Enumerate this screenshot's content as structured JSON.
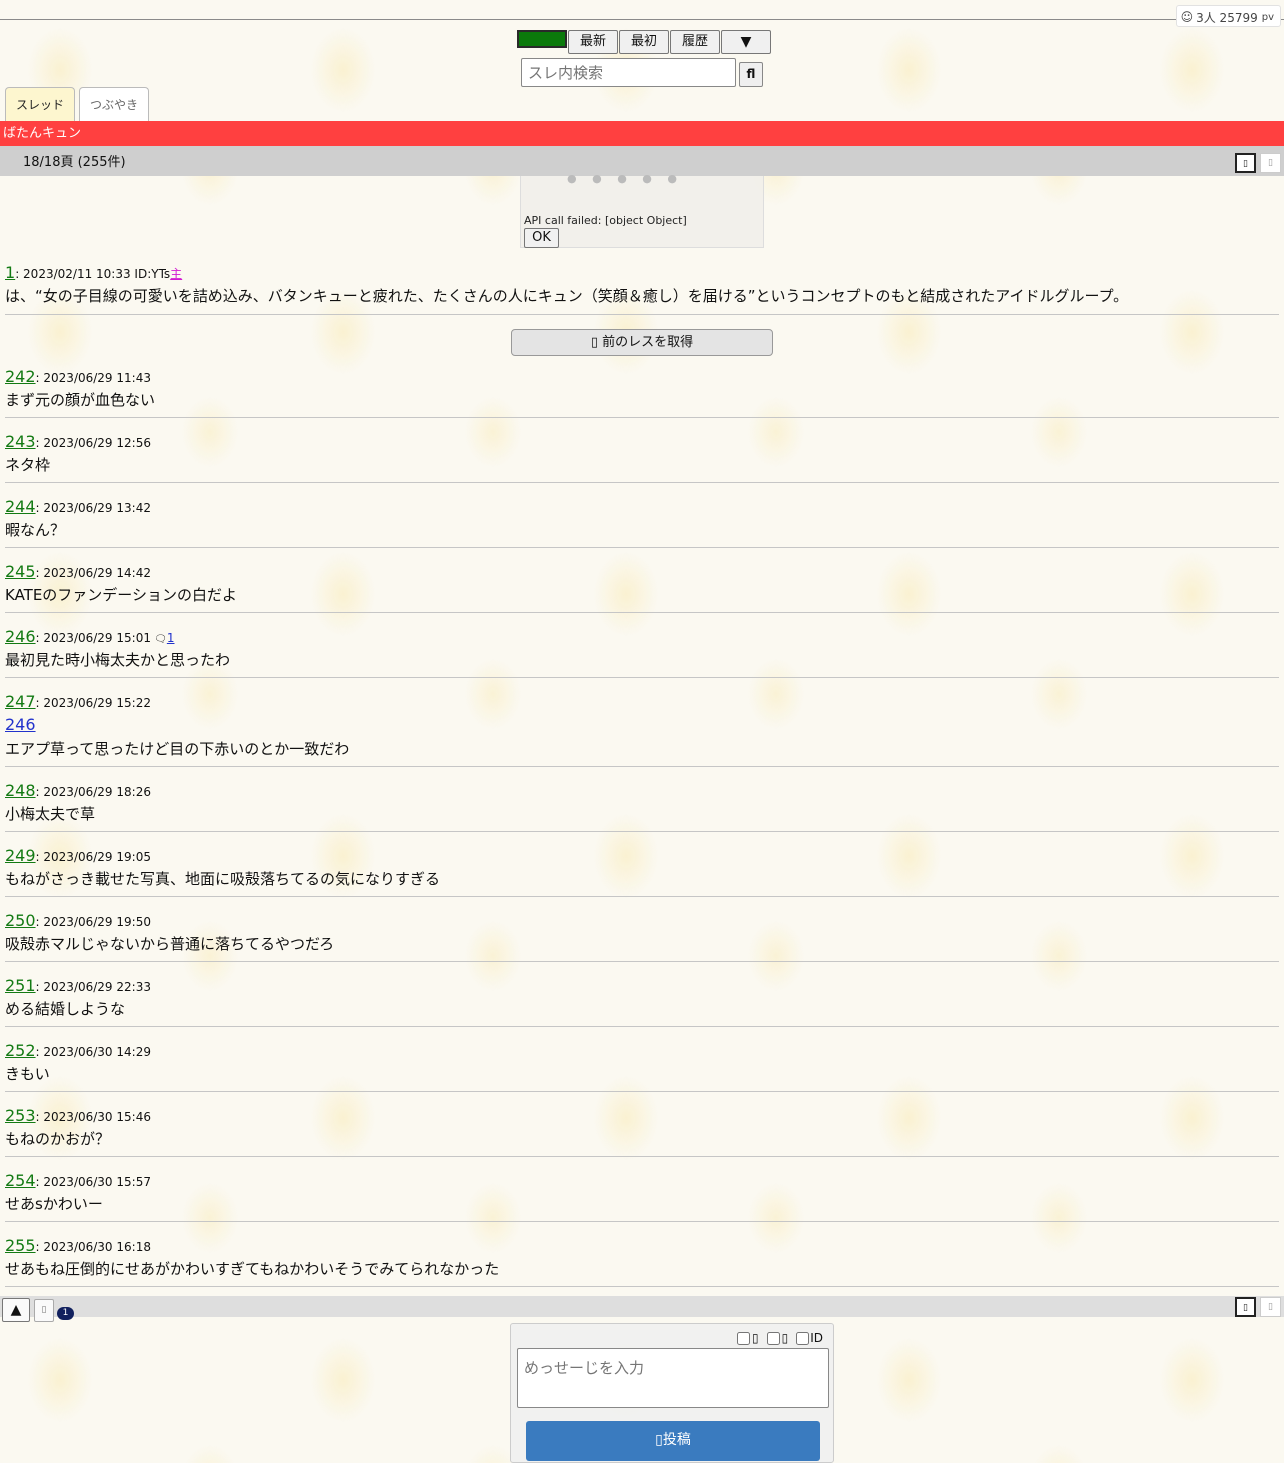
{
  "counter": {
    "icon": "chat-face-icon",
    "people": "3人 25799",
    "unit": "pv"
  },
  "nav": {
    "green_label": "",
    "latest": "最新",
    "first": "最初",
    "history": "履歴",
    "dropdown": "▼"
  },
  "search": {
    "placeholder": "スレ内検索",
    "button": "fl"
  },
  "tabs": {
    "thread": "スレッド",
    "tweet": "つぶやき"
  },
  "thread_title": "ばたんキュン",
  "pager": {
    "text": "18/18頁 (255件)"
  },
  "error": {
    "message": "API call failed: [object Object]",
    "ok": "OK"
  },
  "op": {
    "num": "1",
    "meta": ": 2023/02/11 10:33 ID:YTs",
    "owner": "主",
    "body": "は、“女の子目線の可愛いを詰め込み、バタンキューと疲れた、たくさんの人にキュン（笑顔＆癒し）を届ける”というコンセプトのもと結成されたアイドルグループ。"
  },
  "prev_button": "前のレスを取得",
  "posts": [
    {
      "num": "242",
      "date": "2023/06/29 11:43",
      "body": "まず元の顔が血色ない"
    },
    {
      "num": "243",
      "date": "2023/06/29 12:56",
      "body": "ネタ枠"
    },
    {
      "num": "244",
      "date": "2023/06/29 13:42",
      "body": "暇なん？"
    },
    {
      "num": "245",
      "date": "2023/06/29 14:42",
      "body": "KATEのファンデーションの白だよ"
    },
    {
      "num": "246",
      "date": "2023/06/29 15:01",
      "replies": "1",
      "body": "最初見た時小梅太夫かと思ったわ"
    },
    {
      "num": "247",
      "date": "2023/06/29 15:22",
      "anchor": "246",
      "body": "エアプ草って思ったけど目の下赤いのとか一致だわ"
    },
    {
      "num": "248",
      "date": "2023/06/29 18:26",
      "body": "小梅太夫で草"
    },
    {
      "num": "249",
      "date": "2023/06/29 19:05",
      "body": "もねがさっき載せた写真、地面に吸殻落ちてるの気になりすぎる"
    },
    {
      "num": "250",
      "date": "2023/06/29 19:50",
      "body": "吸殻赤マルじゃないから普通に落ちてるやつだろ"
    },
    {
      "num": "251",
      "date": "2023/06/29 22:33",
      "body": "める結婚しような"
    },
    {
      "num": "252",
      "date": "2023/06/30 14:29",
      "body": "きもい"
    },
    {
      "num": "253",
      "date": "2023/06/30 15:46",
      "body": "もねのかおが？"
    },
    {
      "num": "254",
      "date": "2023/06/30 15:57",
      "body": "せあsかわいー"
    },
    {
      "num": "255",
      "date": "2023/06/30 16:18",
      "body": "せあもね圧倒的にせあがかわいすぎてもねかわいそうでみてられなかった"
    }
  ],
  "bottom": {
    "up": "▲",
    "badge": "1"
  },
  "form": {
    "opt1": "",
    "opt2": "",
    "opt3": "ID",
    "placeholder": "めっせーじを入力",
    "submit": "投稿"
  },
  "colors": {
    "title_bar": "#ff4040",
    "post_num": "#137a13",
    "submit": "#3a7bbf",
    "nav_green": "#0b7a0b"
  }
}
